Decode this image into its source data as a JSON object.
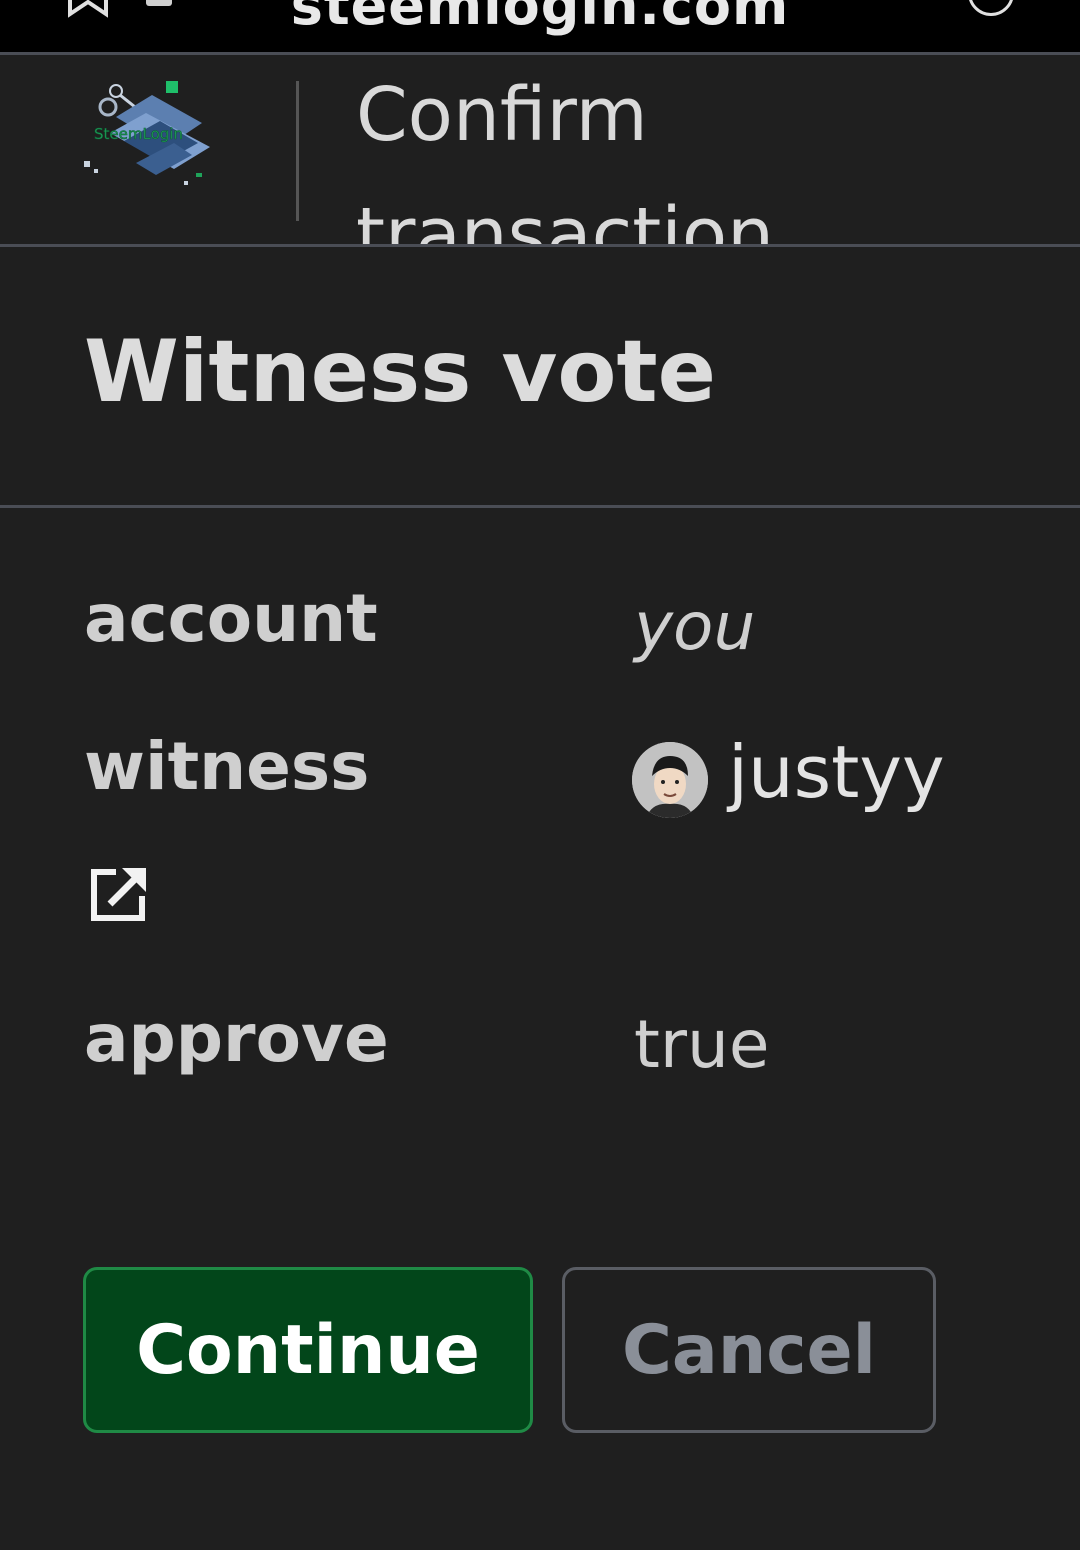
{
  "browser": {
    "url_text": "steemlogin.com"
  },
  "header": {
    "logo_text": "SteemLogin",
    "title": "Confirm transaction (active)"
  },
  "operation": {
    "title": "Witness vote"
  },
  "details": [
    {
      "label": "account",
      "value": "you"
    },
    {
      "label": "witness",
      "value": "justyy"
    },
    {
      "label": "approve",
      "value": "true"
    }
  ],
  "buttons": {
    "continue_label": "Continue",
    "cancel_label": "Cancel"
  },
  "colors": {
    "background": "#1f1f1f",
    "continue_bg": "#02461a",
    "continue_border": "#1f8a45",
    "cancel_text": "#8a8f98",
    "divider": "#4a4d55"
  },
  "icons": [
    "bookmark-icon",
    "tab-icon",
    "menu-icon",
    "steemlogin-logo",
    "avatar",
    "external-link-icon"
  ]
}
